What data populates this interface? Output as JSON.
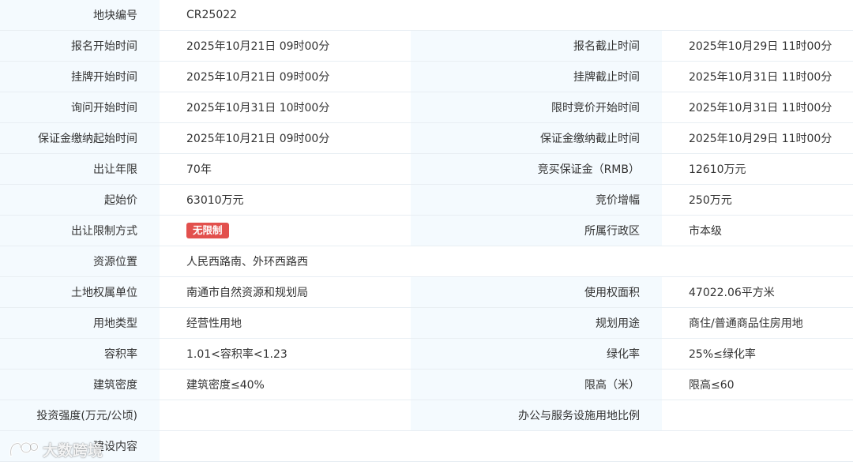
{
  "rows": [
    {
      "l1": "地块编号",
      "v1": "CR25022"
    },
    {
      "l1": "报名开始时间",
      "v1": "2025年10月21日 09时00分",
      "l2": "报名截止时间",
      "v2": "2025年10月29日 11时00分"
    },
    {
      "l1": "挂牌开始时间",
      "v1": "2025年10月21日 09时00分",
      "l2": "挂牌截止时间",
      "v2": "2025年10月31日 11时00分"
    },
    {
      "l1": "询问开始时间",
      "v1": "2025年10月31日 10时00分",
      "l2": "限时竞价开始时间",
      "v2": "2025年10月31日 11时00分"
    },
    {
      "l1": "保证金缴纳起始时间",
      "v1": "2025年10月21日 09时00分",
      "l2": "保证金缴纳截止时间",
      "v2": "2025年10月29日 11时00分"
    },
    {
      "l1": "出让年限",
      "v1": "70年",
      "l2": "竞买保证金（RMB）",
      "v2": "12610万元"
    },
    {
      "l1": "起始价",
      "v1": "63010万元",
      "l2": "竞价增幅",
      "v2": "250万元"
    },
    {
      "l1": "出让限制方式",
      "badge": "无限制",
      "l2": "所属行政区",
      "v2": "市本级"
    },
    {
      "l1": "资源位置",
      "v1": "人民西路南、外环西路西"
    },
    {
      "l1": "土地权属单位",
      "v1": "南通市自然资源和规划局",
      "l2": "使用权面积",
      "v2": "47022.06平方米"
    },
    {
      "l1": "用地类型",
      "v1": "经营性用地",
      "l2": "规划用途",
      "v2": "商住/普通商品住房用地"
    },
    {
      "l1": "容积率",
      "v1": "1.01<容积率<1.23",
      "l2": "绿化率",
      "v2": "25%≤绿化率"
    },
    {
      "l1": "建筑密度",
      "v1": "建筑密度≤40%",
      "l2": "限高（米）",
      "v2": "限高≤60"
    },
    {
      "l1": "投资强度(万元/公顷)",
      "v1": "",
      "l2": "办公与服务设施用地比例",
      "v2": ""
    },
    {
      "l1": "建设内容",
      "v1": ""
    }
  ],
  "watermark": {
    "text": "大数跨境"
  },
  "colors": {
    "label_bg": "#f4fafe",
    "border": "#e8eef3",
    "badge": "#e2504d"
  }
}
